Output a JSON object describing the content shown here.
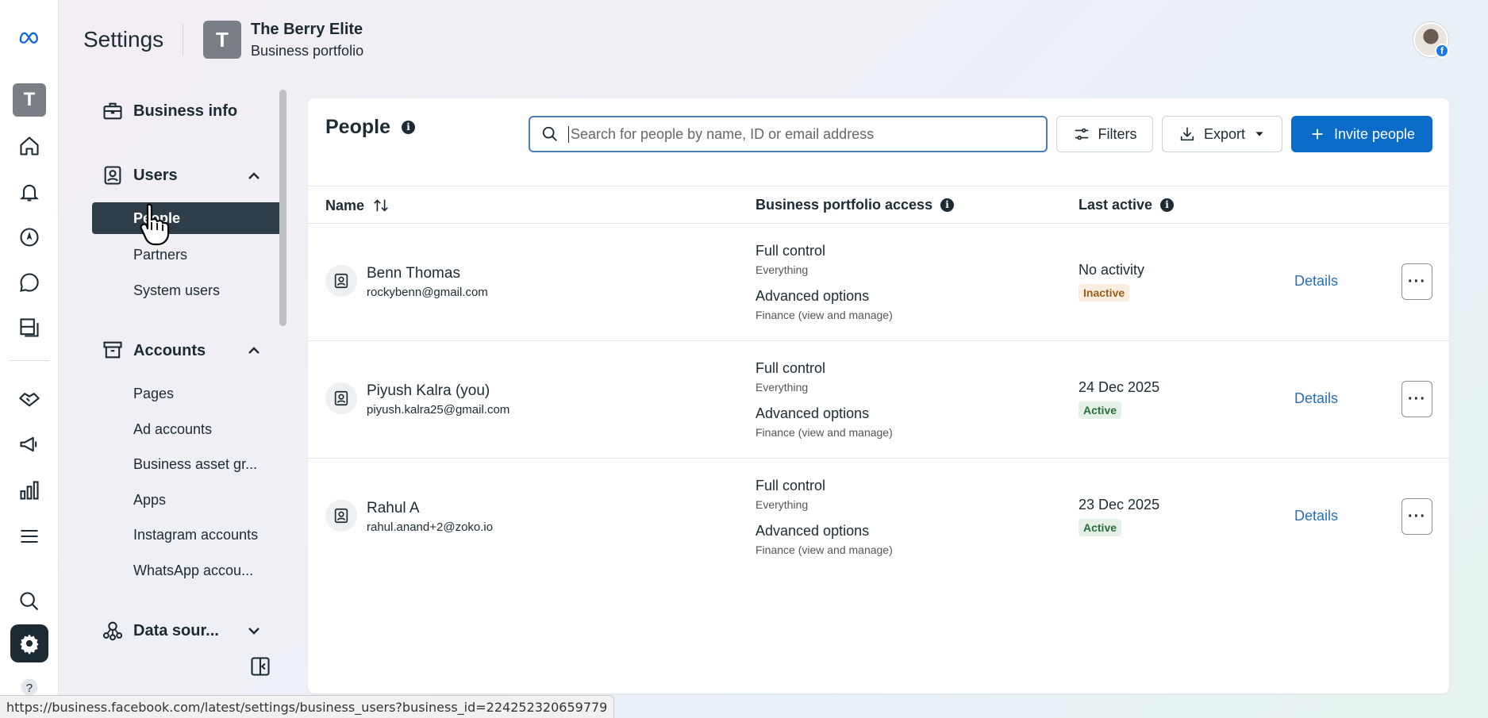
{
  "header": {
    "title": "Settings",
    "portfolio_initial": "T",
    "portfolio_name": "The Berry Elite",
    "portfolio_subtitle": "Business portfolio",
    "profile_badge": "f"
  },
  "rail": {
    "account_initial": "T",
    "icons": [
      "meta-logo-icon",
      "home-icon",
      "bell-icon",
      "compass-icon",
      "chat-icon",
      "pages-icon",
      "handshake-icon",
      "megaphone-icon",
      "bar-chart-icon",
      "menu-icon",
      "search-icon",
      "gear-icon",
      "help-icon"
    ]
  },
  "sidebar": {
    "groups": [
      {
        "label": "Business info"
      },
      {
        "label": "Users",
        "items": [
          "People",
          "Partners",
          "System users"
        ],
        "active": "People"
      },
      {
        "label": "Accounts",
        "items": [
          "Pages",
          "Ad accounts",
          "Business asset gr...",
          "Apps",
          "Instagram accounts",
          "WhatsApp accou..."
        ]
      },
      {
        "label": "Data sour..."
      }
    ]
  },
  "main": {
    "title": "People",
    "search_placeholder": "Search for people by name, ID or email address",
    "filters_label": "Filters",
    "export_label": "Export",
    "invite_label": "Invite people",
    "columns": [
      "Name",
      "Business portfolio access",
      "Last active"
    ],
    "rows": [
      {
        "name": "Benn Thomas",
        "email": "rockybenn@gmail.com",
        "access1": "Full control",
        "access1_sub": "Everything",
        "access2": "Advanced options",
        "access2_sub": "Finance (view and manage)",
        "last_active": "No activity",
        "status": "Inactive",
        "details": "Details"
      },
      {
        "name": "Piyush Kalra (you)",
        "email": "piyush.kalra25@gmail.com",
        "access1": "Full control",
        "access1_sub": "Everything",
        "access2": "Advanced options",
        "access2_sub": "Finance (view and manage)",
        "last_active": "24 Dec 2025",
        "status": "Active",
        "details": "Details"
      },
      {
        "name": "Rahul A",
        "email": "rahul.anand+2@zoko.io",
        "access1": "Full control",
        "access1_sub": "Everything",
        "access2": "Advanced options",
        "access2_sub": "Finance (view and manage)",
        "last_active": "23 Dec 2025",
        "status": "Active",
        "details": "Details"
      }
    ]
  },
  "statusbar": {
    "url": "https://business.facebook.com/latest/settings/business_users?business_id=224252320659779"
  },
  "colors": {
    "primary": "#0a6cc8",
    "nav_active": "#2d3e4a",
    "active_badge_bg": "#e3f1e6",
    "inactive_badge_bg": "#fbeee0"
  }
}
